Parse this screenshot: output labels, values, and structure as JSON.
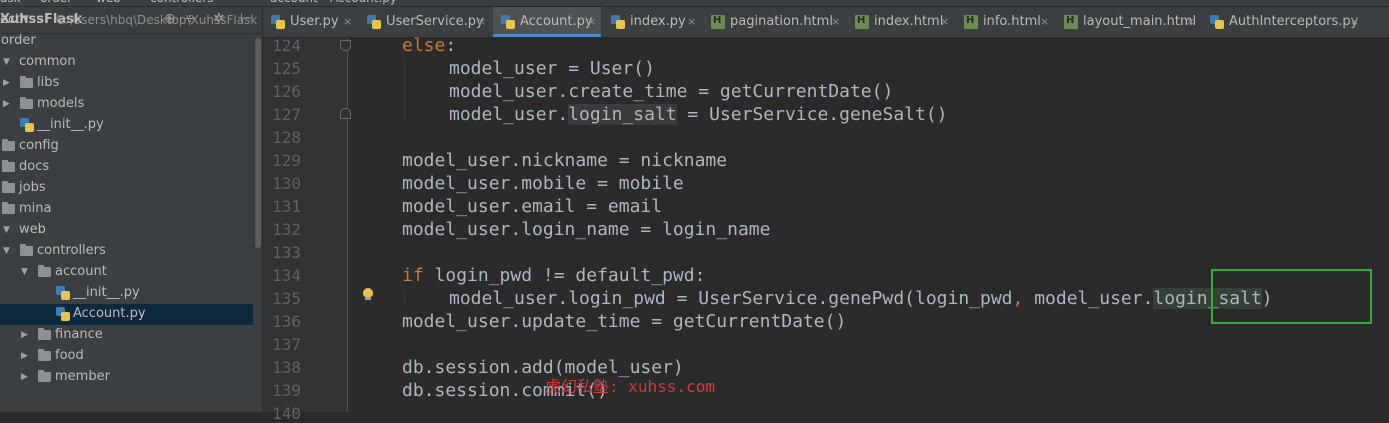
{
  "breadcrumbs": [
    "ask",
    "order",
    "web",
    "controllers",
    "account",
    "Account.py"
  ],
  "project_panel": {
    "title": "ect",
    "icons": [
      "target-icon",
      "split-icon",
      "gear-icon",
      "hide-icon"
    ],
    "tree": [
      {
        "label": "XuhssFlask",
        "path": "C:\\Users\\hbq\\Desktop\\XuhssFlask",
        "type": "root",
        "depth": 0
      },
      {
        "label": "order",
        "type": "folder-plain",
        "depth": 0
      },
      {
        "label": "common",
        "type": "folder",
        "expanded": true,
        "depth": 0
      },
      {
        "label": "libs",
        "type": "folder",
        "expanded": false,
        "depth": 1
      },
      {
        "label": "models",
        "type": "folder",
        "expanded": false,
        "depth": 1
      },
      {
        "label": "__init__.py",
        "type": "py",
        "depth": 2
      },
      {
        "label": "config",
        "type": "folder",
        "depth": 0
      },
      {
        "label": "docs",
        "type": "folder",
        "depth": 0
      },
      {
        "label": "jobs",
        "type": "folder",
        "depth": 0
      },
      {
        "label": "mina",
        "type": "folder",
        "depth": 0
      },
      {
        "label": "web",
        "type": "folder",
        "expanded": true,
        "depth": 0
      },
      {
        "label": "controllers",
        "type": "folder",
        "expanded": true,
        "depth": 1
      },
      {
        "label": "account",
        "type": "folder",
        "expanded": true,
        "depth": 2
      },
      {
        "label": "__init__.py",
        "type": "py",
        "depth": 3
      },
      {
        "label": "Account.py",
        "type": "py",
        "depth": 3,
        "selected": true
      },
      {
        "label": "finance",
        "type": "folder",
        "expanded": false,
        "depth": 2
      },
      {
        "label": "food",
        "type": "folder",
        "expanded": false,
        "depth": 2
      },
      {
        "label": "member",
        "type": "folder",
        "expanded": false,
        "depth": 2
      }
    ]
  },
  "tabs": [
    {
      "label": "User.py",
      "kind": "py",
      "active": false
    },
    {
      "label": "UserService.py",
      "kind": "py",
      "active": false
    },
    {
      "label": "Account.py",
      "kind": "py",
      "active": true
    },
    {
      "label": "index.py",
      "kind": "py",
      "active": false
    },
    {
      "label": "pagination.html",
      "kind": "html",
      "active": false
    },
    {
      "label": "index.html",
      "kind": "html",
      "active": false
    },
    {
      "label": "info.html",
      "kind": "html",
      "active": false
    },
    {
      "label": "layout_main.html",
      "kind": "html",
      "active": false
    },
    {
      "label": "AuthInterceptors.py",
      "kind": "py",
      "active": false
    }
  ],
  "tab_close_glyph": "×",
  "code_lines": [
    {
      "n": "124",
      "indent": 4,
      "text": "else:"
    },
    {
      "n": "125",
      "indent": 8,
      "text": "model_user = User()"
    },
    {
      "n": "126",
      "indent": 8,
      "text": "model_user.create_time = getCurrentDate()"
    },
    {
      "n": "127",
      "indent": 8,
      "text": "model_user.login_salt = UserService.geneSalt()"
    },
    {
      "n": "128",
      "indent": 0,
      "text": ""
    },
    {
      "n": "129",
      "indent": 4,
      "text": "model_user.nickname = nickname"
    },
    {
      "n": "130",
      "indent": 4,
      "text": "model_user.mobile = mobile"
    },
    {
      "n": "131",
      "indent": 4,
      "text": "model_user.email = email"
    },
    {
      "n": "132",
      "indent": 4,
      "text": "model_user.login_name = login_name"
    },
    {
      "n": "133",
      "indent": 0,
      "text": ""
    },
    {
      "n": "134",
      "indent": 4,
      "text": "if login_pwd != default_pwd:"
    },
    {
      "n": "135",
      "indent": 8,
      "text": "model_user.login_pwd = UserService.genePwd(login_pwd, model_user.login_salt)"
    },
    {
      "n": "136",
      "indent": 4,
      "text": "model_user.update_time = getCurrentDate()"
    },
    {
      "n": "137",
      "indent": 0,
      "text": ""
    },
    {
      "n": "138",
      "indent": 4,
      "text": "db.session.add(model_user)"
    },
    {
      "n": "139",
      "indent": 4,
      "text": "db.session.commit()"
    },
    {
      "n": "140",
      "indent": 0,
      "text": ""
    }
  ],
  "watermark": "虎幻私塾: xuhss.com",
  "colors": {
    "keyword": "#cc7832",
    "highlight_box": "#2eb135",
    "watermark": "#d43a3a"
  }
}
